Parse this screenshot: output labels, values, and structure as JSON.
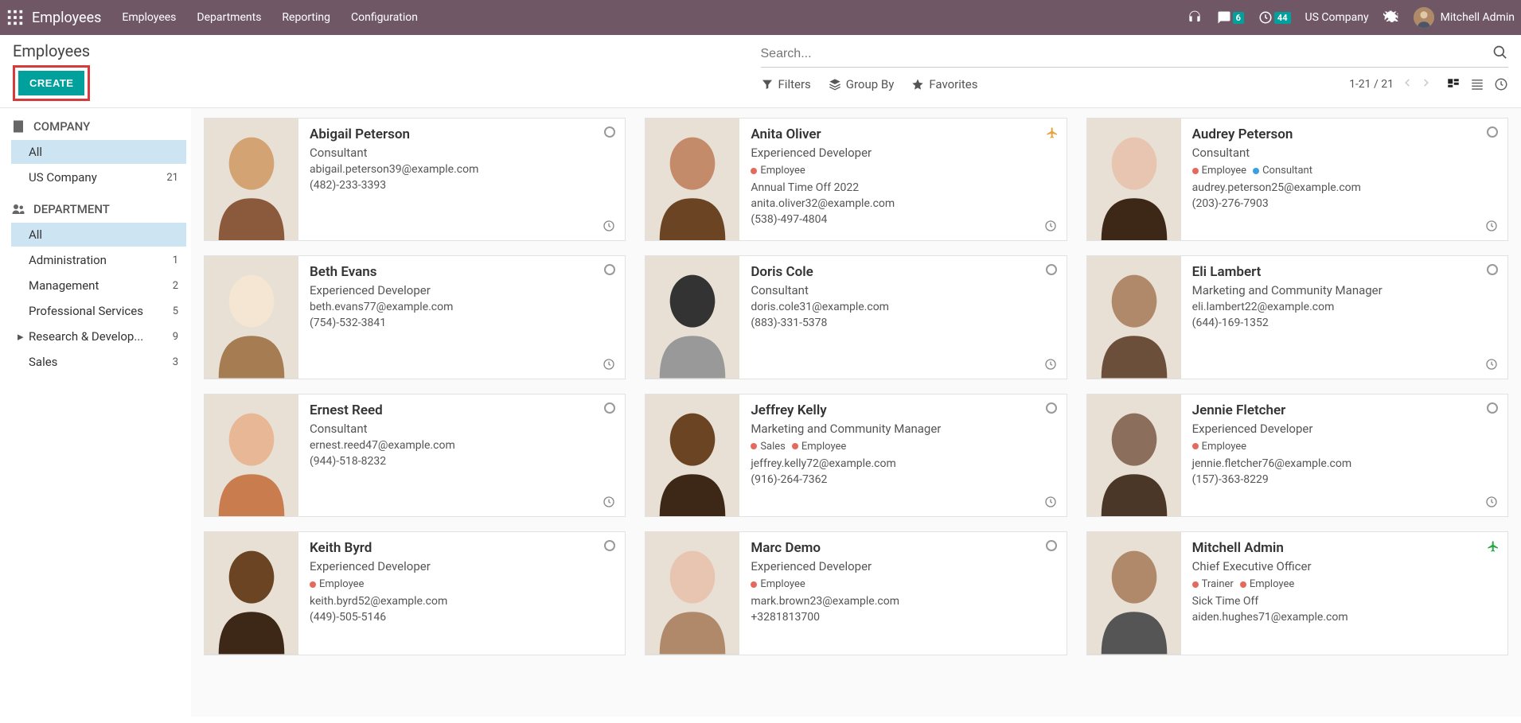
{
  "navbar": {
    "brand": "Employees",
    "menu": [
      "Employees",
      "Departments",
      "Reporting",
      "Configuration"
    ],
    "msg_badge": "6",
    "act_badge": "44",
    "company": "US Company",
    "user": "Mitchell Admin"
  },
  "control": {
    "title": "Employees",
    "create": "CREATE",
    "search_placeholder": "Search...",
    "filters": "Filters",
    "groupby": "Group By",
    "favorites": "Favorites",
    "pager": "1-21 / 21"
  },
  "sidebar": {
    "company_head": "COMPANY",
    "company_items": [
      {
        "label": "All",
        "count": "",
        "selected": true
      },
      {
        "label": "US Company",
        "count": "21",
        "selected": false
      }
    ],
    "dept_head": "DEPARTMENT",
    "dept_items": [
      {
        "label": "All",
        "count": "",
        "selected": true,
        "caret": false
      },
      {
        "label": "Administration",
        "count": "1",
        "selected": false,
        "caret": false
      },
      {
        "label": "Management",
        "count": "2",
        "selected": false,
        "caret": false
      },
      {
        "label": "Professional Services",
        "count": "5",
        "selected": false,
        "caret": false
      },
      {
        "label": "Research & Develop...",
        "count": "9",
        "selected": false,
        "caret": true
      },
      {
        "label": "Sales",
        "count": "3",
        "selected": false,
        "caret": false
      }
    ]
  },
  "colors": {
    "red": "#e46a5e",
    "blue": "#3b9fe0",
    "orange": "#e6a23c",
    "green": "#28a745"
  },
  "cards": [
    {
      "name": "Abigail Peterson",
      "job": "Consultant",
      "tags": [],
      "leave": "",
      "email": "abigail.peterson39@example.com",
      "phone": "(482)-233-3393",
      "top": "circle",
      "bot": "clock",
      "photo": 1
    },
    {
      "name": "Anita Oliver",
      "job": "Experienced Developer",
      "tags": [
        {
          "c": "red",
          "t": "Employee"
        }
      ],
      "leave": "Annual Time Off 2022",
      "email": "anita.oliver32@example.com",
      "phone": "(538)-497-4804",
      "top": "plane",
      "bot": "clock",
      "photo": 2
    },
    {
      "name": "Audrey Peterson",
      "job": "Consultant",
      "tags": [
        {
          "c": "red",
          "t": "Employee"
        },
        {
          "c": "blue",
          "t": "Consultant"
        }
      ],
      "leave": "",
      "email": "audrey.peterson25@example.com",
      "phone": "(203)-276-7903",
      "top": "circle",
      "bot": "clock",
      "photo": 3
    },
    {
      "name": "Beth Evans",
      "job": "Experienced Developer",
      "tags": [],
      "leave": "",
      "email": "beth.evans77@example.com",
      "phone": "(754)-532-3841",
      "top": "circle",
      "bot": "clock",
      "photo": 4
    },
    {
      "name": "Doris Cole",
      "job": "Consultant",
      "tags": [],
      "leave": "",
      "email": "doris.cole31@example.com",
      "phone": "(883)-331-5378",
      "top": "circle",
      "bot": "clock",
      "photo": 5
    },
    {
      "name": "Eli Lambert",
      "job": "Marketing and Community Manager",
      "tags": [],
      "leave": "",
      "email": "eli.lambert22@example.com",
      "phone": "(644)-169-1352",
      "top": "circle",
      "bot": "clock",
      "photo": 6
    },
    {
      "name": "Ernest Reed",
      "job": "Consultant",
      "tags": [],
      "leave": "",
      "email": "ernest.reed47@example.com",
      "phone": "(944)-518-8232",
      "top": "circle",
      "bot": "clock",
      "photo": 7
    },
    {
      "name": "Jeffrey Kelly",
      "job": "Marketing and Community Manager",
      "tags": [
        {
          "c": "red",
          "t": "Sales"
        },
        {
          "c": "red",
          "t": "Employee"
        }
      ],
      "leave": "",
      "email": "jeffrey.kelly72@example.com",
      "phone": "(916)-264-7362",
      "top": "circle",
      "bot": "clock",
      "photo": 8
    },
    {
      "name": "Jennie Fletcher",
      "job": "Experienced Developer",
      "tags": [
        {
          "c": "red",
          "t": "Employee"
        }
      ],
      "leave": "",
      "email": "jennie.fletcher76@example.com",
      "phone": "(157)-363-8229",
      "top": "circle",
      "bot": "clock",
      "photo": 9
    },
    {
      "name": "Keith Byrd",
      "job": "Experienced Developer",
      "tags": [
        {
          "c": "red",
          "t": "Employee"
        }
      ],
      "leave": "",
      "email": "keith.byrd52@example.com",
      "phone": "(449)-505-5146",
      "top": "circle",
      "bot": "",
      "photo": 10
    },
    {
      "name": "Marc Demo",
      "job": "Experienced Developer",
      "tags": [
        {
          "c": "red",
          "t": "Employee"
        }
      ],
      "leave": "",
      "email": "mark.brown23@example.com",
      "phone": "+3281813700",
      "top": "circle",
      "bot": "",
      "photo": 11
    },
    {
      "name": "Mitchell Admin",
      "job": "Chief Executive Officer",
      "tags": [
        {
          "c": "red",
          "t": "Trainer"
        },
        {
          "c": "red",
          "t": "Employee"
        }
      ],
      "leave": "Sick Time Off",
      "email": "aiden.hughes71@example.com",
      "phone": "",
      "top": "plane-g",
      "bot": "",
      "photo": 12
    }
  ]
}
